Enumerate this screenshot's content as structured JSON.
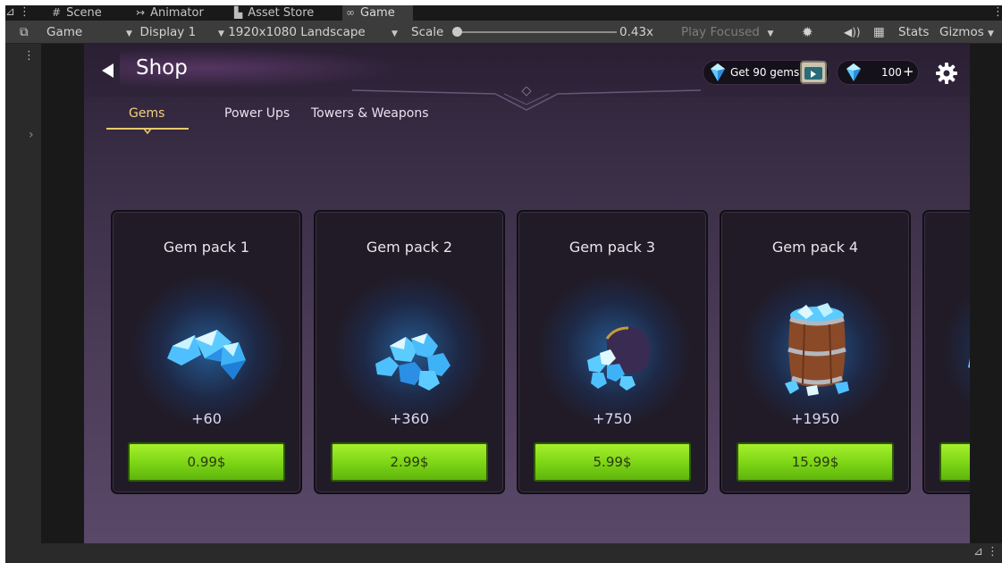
{
  "editor": {
    "tabs": [
      {
        "icon": "#",
        "label": "Scene"
      },
      {
        "icon": "↣",
        "label": "Animator"
      },
      {
        "icon": "▙",
        "label": "Asset Store"
      },
      {
        "icon": "∞",
        "label": "Game"
      }
    ],
    "toolbar": {
      "view_mode": "Game",
      "display": "Display 1",
      "resolution": "1920x1080 Landscape",
      "scale_label": "Scale",
      "scale_value": "0.43x",
      "play_focused": "Play Focused",
      "stats": "Stats",
      "gizmos": "Gizmos"
    }
  },
  "shop": {
    "title": "Shop",
    "get_gems_label": "Get 90 gems",
    "gem_balance": "100",
    "tabs": [
      {
        "label": "Gems",
        "active": true
      },
      {
        "label": "Power Ups",
        "active": false
      },
      {
        "label": "Towers & Weapons",
        "active": false
      }
    ],
    "cards": [
      {
        "name": "Gem pack 1",
        "amount": "+60",
        "price": "0.99$",
        "art": "gem-cluster-icon"
      },
      {
        "name": "Gem pack 2",
        "amount": "+360",
        "price": "2.99$",
        "art": "gem-pile-icon"
      },
      {
        "name": "Gem pack 3",
        "amount": "+750",
        "price": "5.99$",
        "art": "gem-sack-icon"
      },
      {
        "name": "Gem pack 4",
        "amount": "+1950",
        "price": "15.99$",
        "art": "gem-barrel-icon"
      }
    ]
  },
  "colors": {
    "accent_tab": "#f2d27a",
    "buy_button": "#7bd414",
    "gem_blue": "#5cc8ff"
  }
}
